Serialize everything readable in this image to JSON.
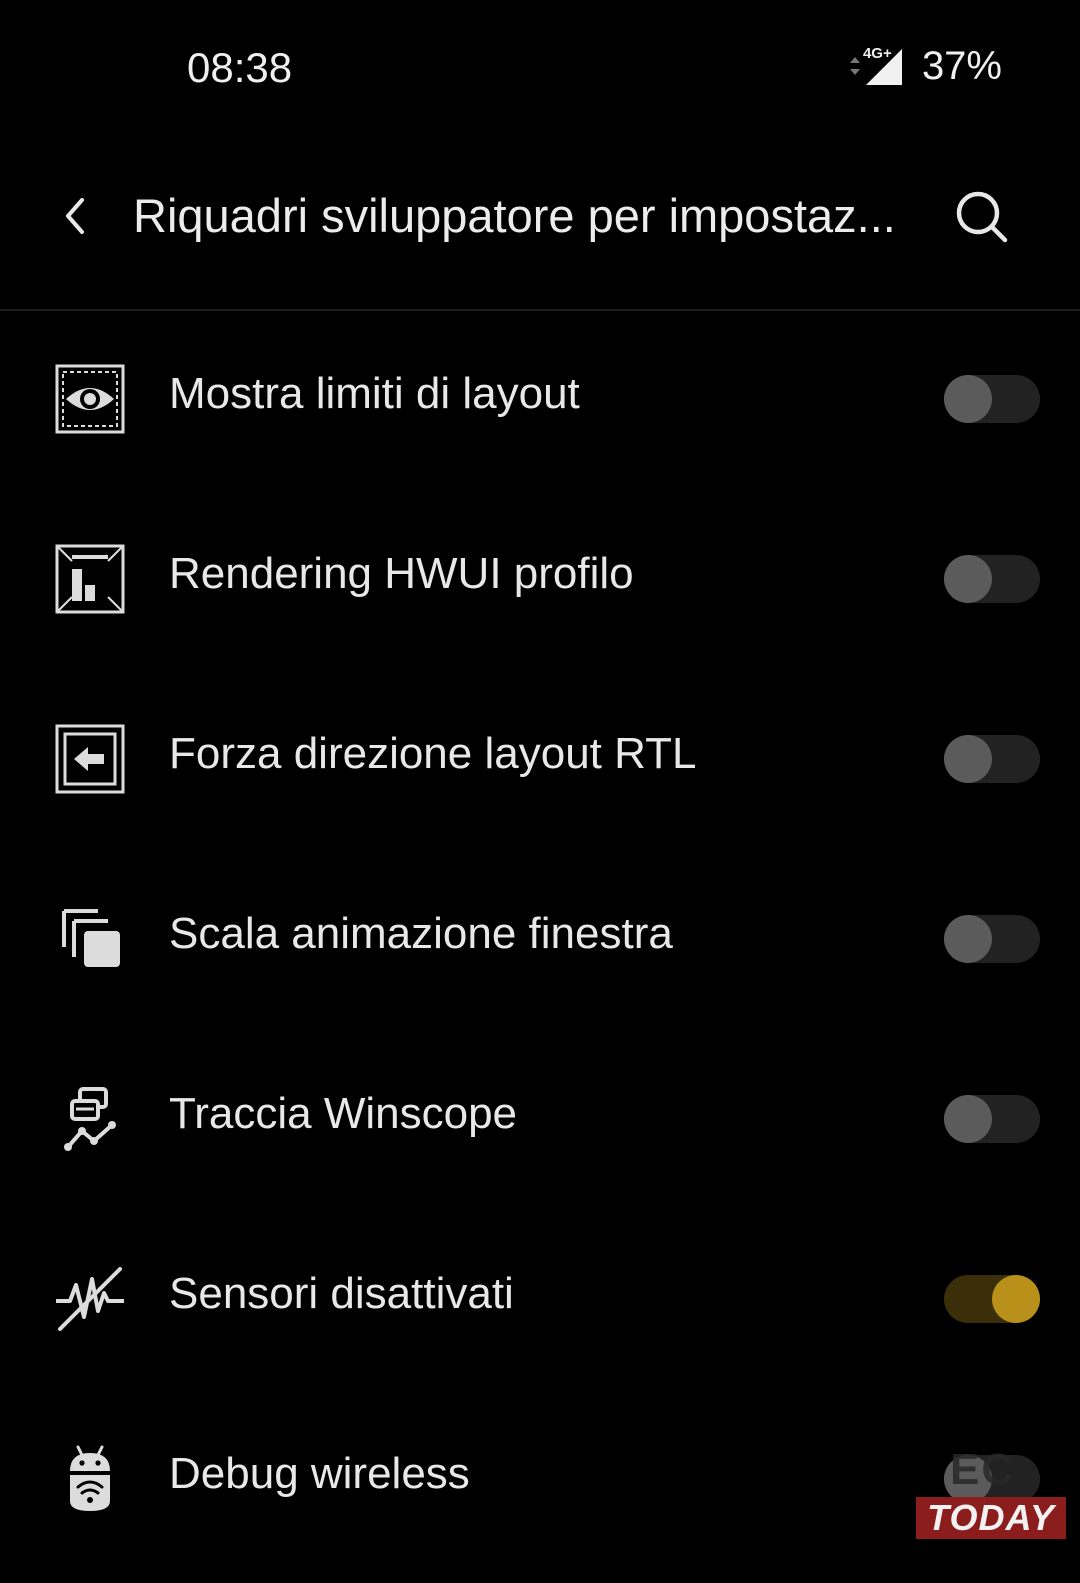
{
  "status_bar": {
    "time": "08:38",
    "network": "4G+",
    "battery": "37%"
  },
  "toolbar": {
    "title": "Riquadri sviluppatore per impostaz...",
    "back_icon": "chevron-left-icon",
    "search_icon": "search-icon"
  },
  "colors": {
    "background": "#000000",
    "toggle_on_accent": "#b8901a",
    "toggle_off_knob": "#5b5b5b"
  },
  "tiles": [
    {
      "label": "Mostra limiti di layout",
      "icon": "eye-bounds-icon",
      "enabled": false
    },
    {
      "label": "Rendering HWUI profilo",
      "icon": "bar-chart-frame-icon",
      "enabled": false
    },
    {
      "label": "Forza direzione layout RTL",
      "icon": "arrow-left-frame-icon",
      "enabled": false
    },
    {
      "label": "Scala animazione finestra",
      "icon": "stacked-windows-icon",
      "enabled": false
    },
    {
      "label": "Traccia Winscope",
      "icon": "winscope-trace-icon",
      "enabled": false
    },
    {
      "label": "Sensori disattivati",
      "icon": "sensors-off-icon",
      "enabled": true
    },
    {
      "label": "Debug wireless",
      "icon": "android-wifi-icon",
      "enabled": false
    }
  ],
  "watermark": {
    "top": "EC",
    "bottom": "TODAY"
  }
}
